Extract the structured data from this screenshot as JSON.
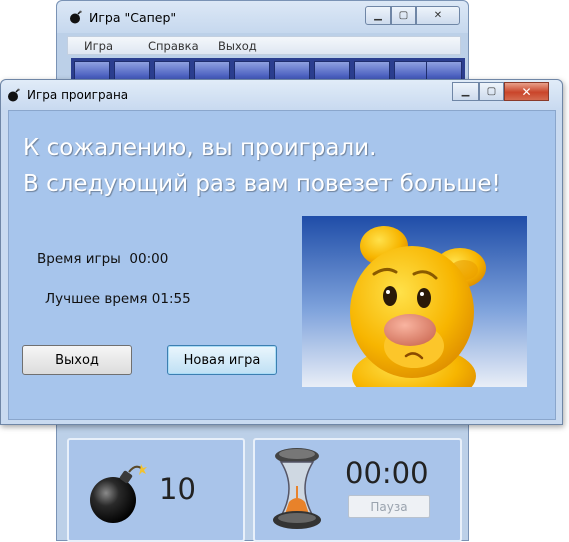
{
  "main_window": {
    "title": "Игра \"Сапер\"",
    "menu": [
      "Игра",
      "Справка",
      "Выход"
    ],
    "mine_count": "10",
    "timer": "00:00",
    "pause_label": "Пауза"
  },
  "dialog": {
    "title": "Игра проиграна",
    "message_line1": "К сожалению, вы проиграли.",
    "message_line2": "В следующий раз вам повезет больше!",
    "game_time_label": "Время игры  00:00",
    "best_time_label": "Лучшее время 01:55",
    "exit_label": "Выход",
    "new_game_label": "Новая игра"
  },
  "icons": {
    "app": "bomb-icon",
    "mine": "bomb-icon",
    "timer": "hourglass-icon",
    "character": "sad-bear-image"
  },
  "colors": {
    "accent": "#a7c5ec",
    "board": "#2b3e8f",
    "close": "#c9452a"
  }
}
